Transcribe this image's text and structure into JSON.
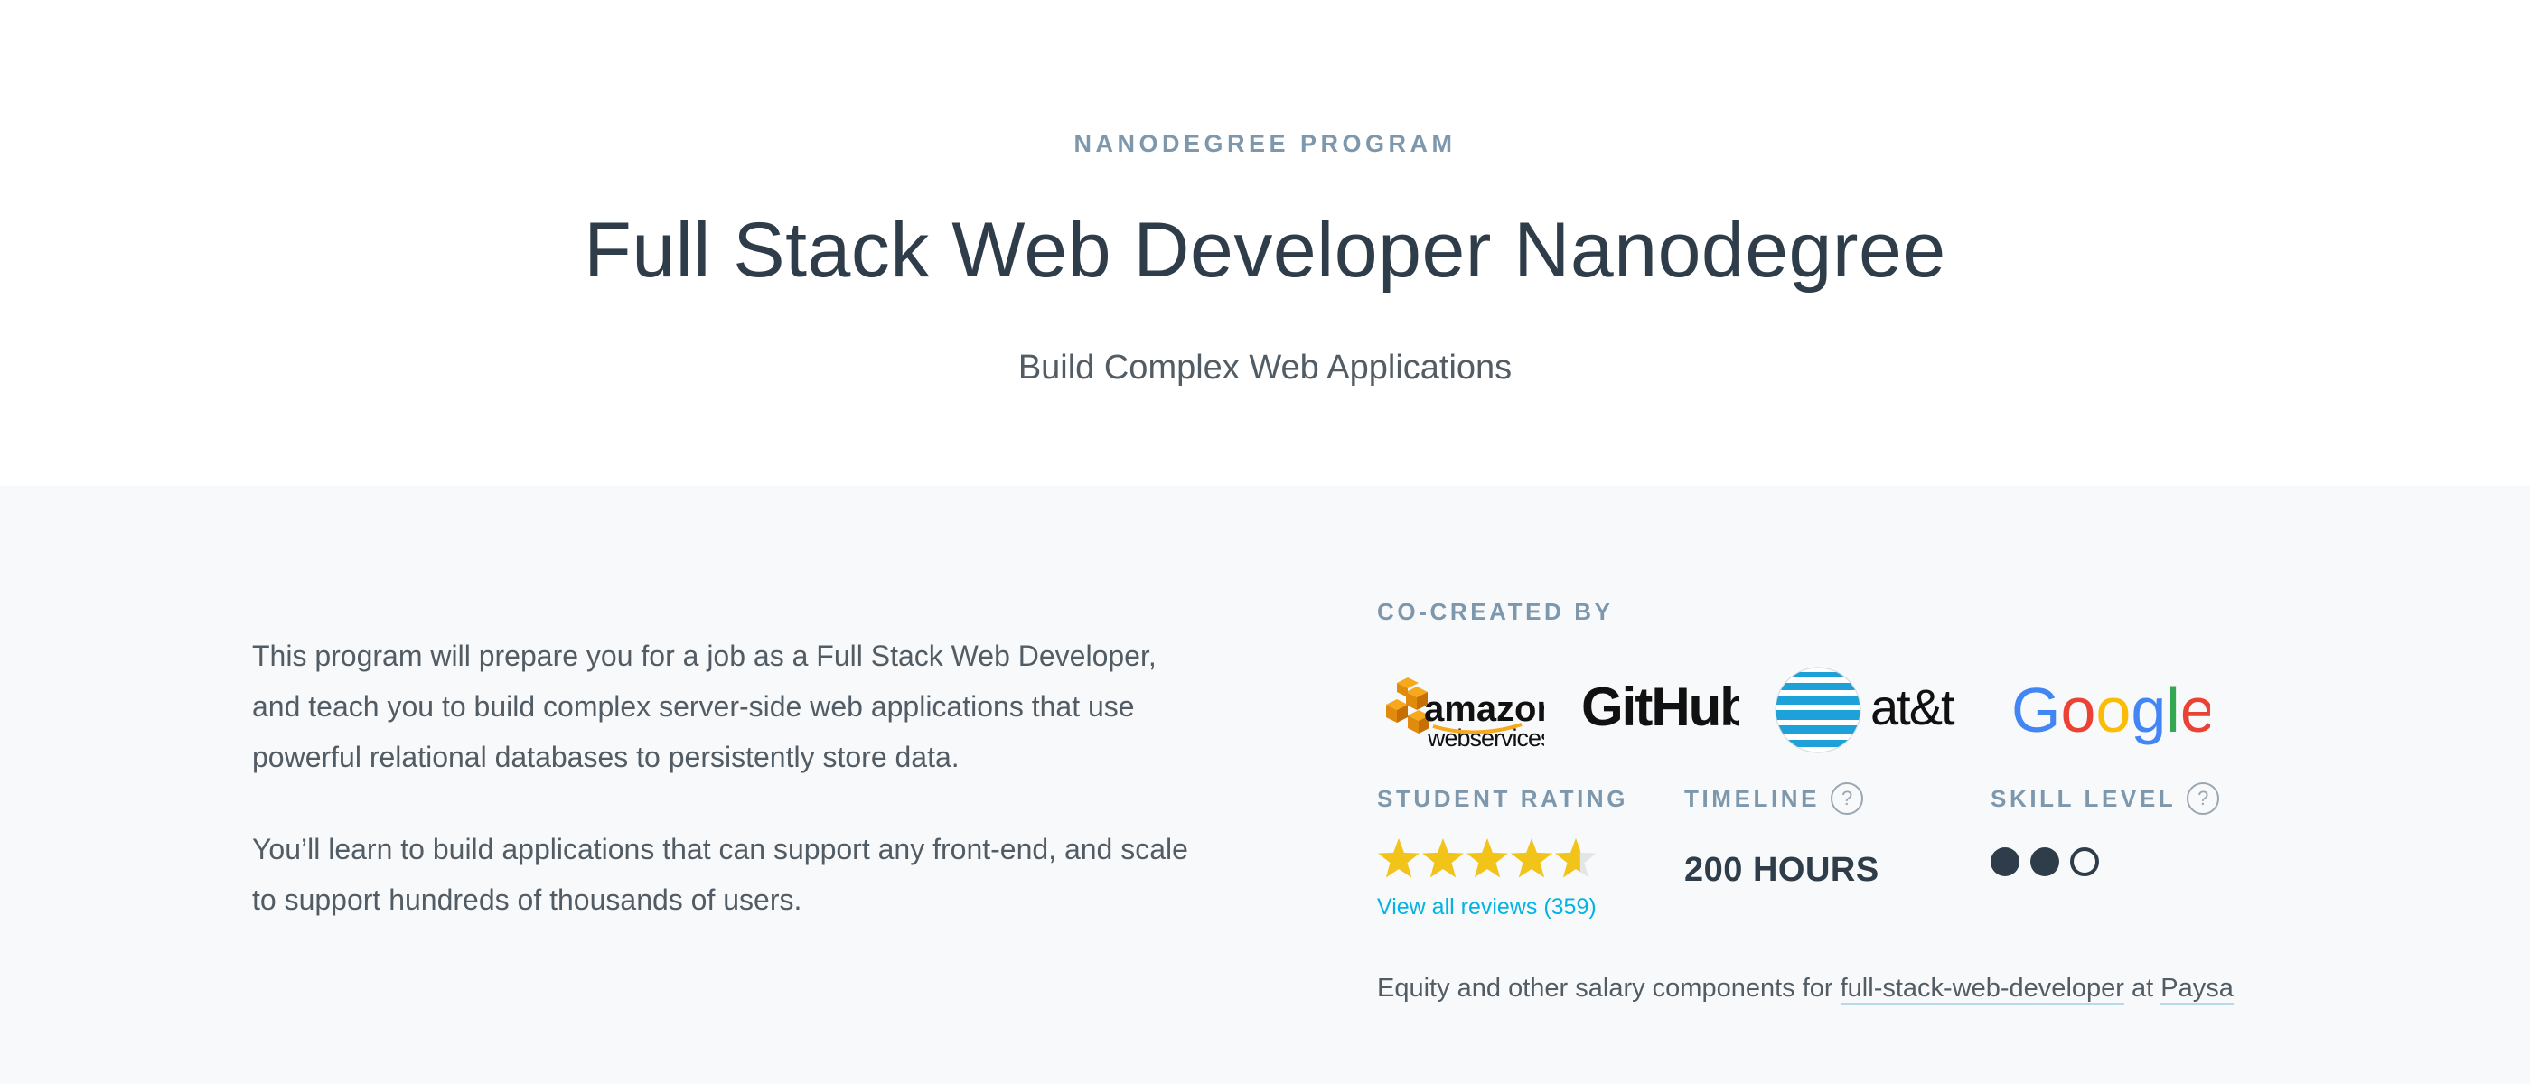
{
  "hero": {
    "eyebrow": "NANODEGREE PROGRAM",
    "title": "Full Stack Web Developer Nanodegree",
    "subtitle": "Build Complex Web Applications"
  },
  "description": {
    "paragraph1": "This program will prepare you for a job as a Full Stack Web Developer, and teach you to build complex server-side web applications that use powerful relational databases to persistently store data.",
    "paragraph2": "You’ll learn to build applications that can support any front-end, and scale to support hundreds of thousands of users."
  },
  "cocreated": {
    "label": "CO-CREATED BY",
    "partners": [
      {
        "name": "amazon web services",
        "line1": "amazon",
        "line2": "webservices",
        "color": "#111111",
        "accent": "#f7a81b"
      },
      {
        "name": "GitHub",
        "text": "GitHub",
        "color": "#111111"
      },
      {
        "name": "at&t",
        "text": "at&t",
        "color": "#111111",
        "accent": "#1ea0d9"
      },
      {
        "name": "Google",
        "letters": [
          "G",
          "o",
          "o",
          "g",
          "l",
          "e"
        ],
        "colors": [
          "#4285f4",
          "#ea4335",
          "#fbbc05",
          "#4285f4",
          "#34a853",
          "#ea4335"
        ]
      }
    ]
  },
  "rating": {
    "label": "STUDENT RATING",
    "stars": 4.6,
    "max_stars": 5,
    "reviews_link": "View all reviews (359)",
    "star_color": "#f2c318"
  },
  "timeline": {
    "label": "TIMELINE",
    "help": "?",
    "value": "200 HOURS"
  },
  "skill": {
    "label": "SKILL LEVEL",
    "help": "?",
    "level": 2,
    "max": 3
  },
  "salary": {
    "prefix": "Equity and other salary components for",
    "role_link": "full-stack-web-developer",
    "middle": "at",
    "source_link": "Paysa"
  }
}
